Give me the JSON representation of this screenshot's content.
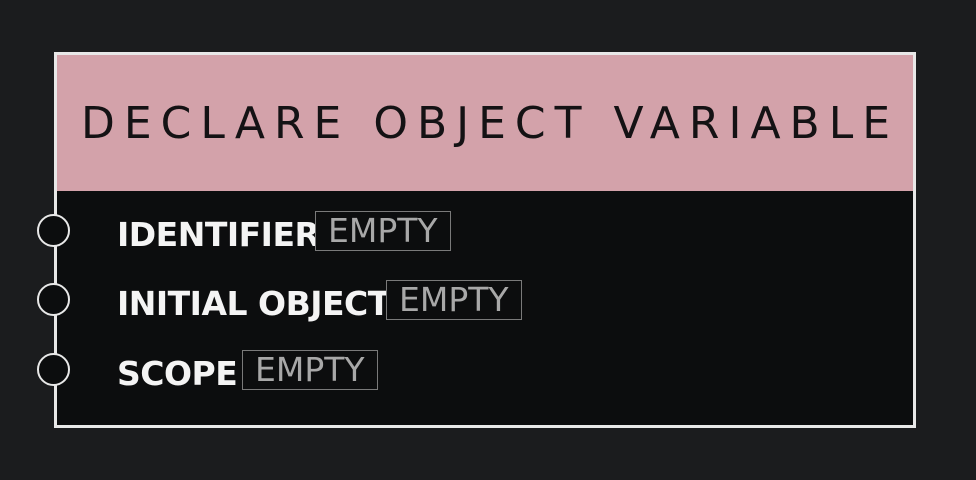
{
  "node": {
    "title": "DECLARE OBJECT VARIABLE",
    "header_color": "#d3a2aa",
    "ports": [
      {
        "label": "IDENTIFIER",
        "value": "EMPTY"
      },
      {
        "label": "INITIAL OBJECT",
        "value": "EMPTY"
      },
      {
        "label": "SCOPE",
        "value": "EMPTY"
      }
    ]
  }
}
